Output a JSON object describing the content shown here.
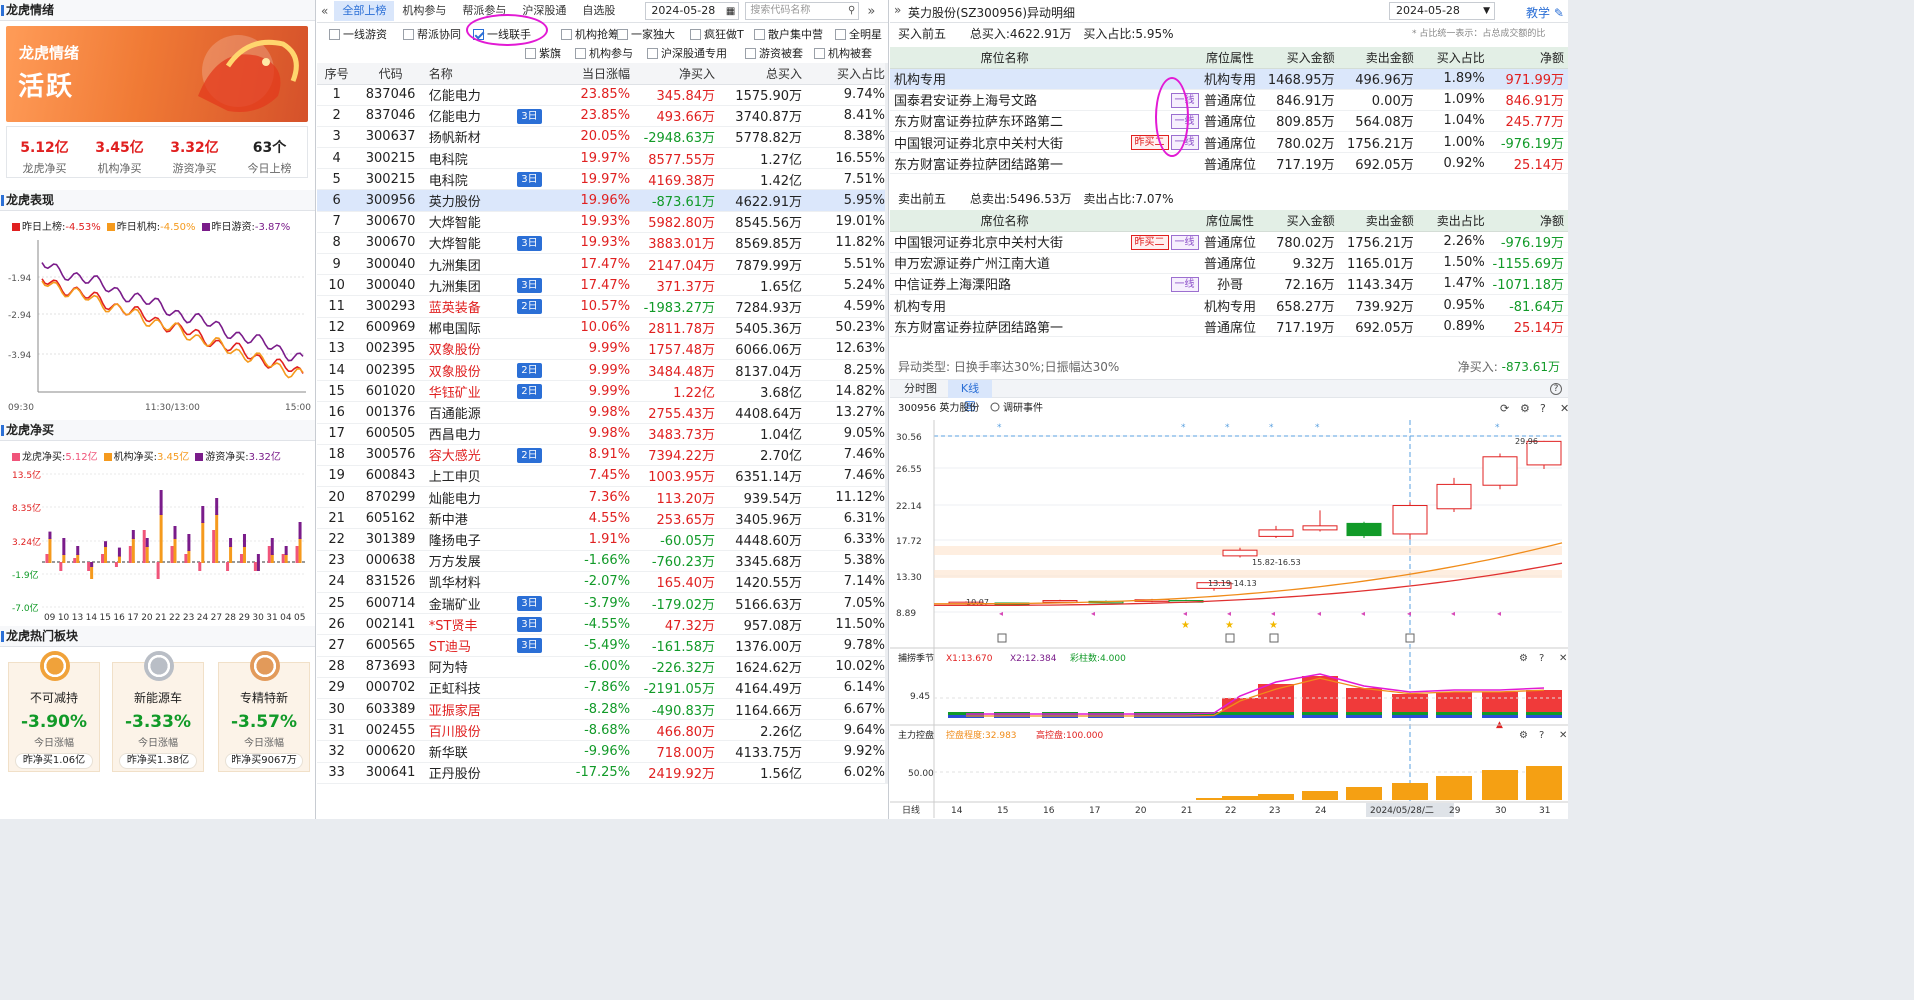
{
  "left": {
    "title": "龙虎情绪",
    "banner": {
      "subtitle": "龙虎情绪",
      "status": "活跃"
    },
    "stats": [
      {
        "value": "5.12亿",
        "label": "龙虎净买"
      },
      {
        "value": "3.45亿",
        "label": "机构净买"
      },
      {
        "value": "3.32亿",
        "label": "游资净买"
      },
      {
        "value": "63个",
        "label": "今日上榜"
      }
    ],
    "perf": {
      "title": "龙虎表现",
      "legend": [
        {
          "label": "昨日上榜:",
          "value": "-4.53%",
          "color": "#e02020"
        },
        {
          "label": "昨日机构:",
          "value": "-4.50%",
          "color": "#f59a1d"
        },
        {
          "label": "昨日游资:",
          "value": "-3.87%",
          "color": "#7a1c8a"
        }
      ],
      "yticks": [
        "-1.94",
        "-2.94",
        "-3.94"
      ],
      "xticks": [
        "09:30",
        "11:30/13:00",
        "15:00"
      ]
    },
    "net": {
      "title": "龙虎净买",
      "legend": [
        {
          "label": "龙虎净买:",
          "value": "5.12亿",
          "color": "#f0557a"
        },
        {
          "label": "机构净买:",
          "value": "3.45亿",
          "color": "#f59a1d"
        },
        {
          "label": "游资净买:",
          "value": "3.32亿",
          "color": "#7a1c8a"
        }
      ],
      "yticks": [
        "13.5亿",
        "8.35亿",
        "3.24亿",
        "-1.9亿",
        "-7.0亿"
      ],
      "xticks": [
        "09",
        "10",
        "13",
        "14",
        "15",
        "16",
        "17",
        "20",
        "21",
        "22",
        "23",
        "24",
        "27",
        "28",
        "29",
        "30",
        "31",
        "04",
        "05"
      ]
    },
    "hot": {
      "title": "龙虎热门板块",
      "cards": [
        {
          "name": "不可减持",
          "pct": "-3.90%",
          "sub": "今日涨幅",
          "buy": "昨净买1.06亿",
          "medal": "#f0a23a"
        },
        {
          "name": "新能源车",
          "pct": "-3.33%",
          "sub": "今日涨幅",
          "buy": "昨净买1.38亿",
          "medal": "#b9bec6"
        },
        {
          "name": "专精特新",
          "pct": "-3.57%",
          "sub": "今日涨幅",
          "buy": "昨净买9067万",
          "medal": "#e29a5a"
        }
      ]
    }
  },
  "mid": {
    "tabs": [
      "全部上榜",
      "机构参与",
      "帮派参与",
      "沪深股通",
      "自选股"
    ],
    "date": "2024-05-28",
    "search_placeholder": "搜索代码名称",
    "filters": [
      {
        "label": "一线游资",
        "on": false
      },
      {
        "label": "帮派协同",
        "on": false
      },
      {
        "label": "一线联手",
        "on": true
      },
      {
        "label": "机构抢筹",
        "on": false
      },
      {
        "label": "一家独大",
        "on": false
      },
      {
        "label": "疯狂做T",
        "on": false
      },
      {
        "label": "散户集中营",
        "on": false
      },
      {
        "label": "全明星",
        "on": false
      },
      {
        "label": "紫旗",
        "on": false
      },
      {
        "label": "机构参与",
        "on": false
      },
      {
        "label": "沪深股通专用",
        "on": false
      },
      {
        "label": "游资被套",
        "on": false
      },
      {
        "label": "机构被套",
        "on": false
      }
    ],
    "columns": [
      "序号",
      "代码",
      "名称",
      "",
      "当日涨幅",
      "净买入",
      "总买入",
      "买入占比"
    ],
    "rows": [
      [
        "1",
        "837046",
        "亿能电力",
        "",
        "23.85%",
        "345.84万",
        "1575.90万",
        "9.74%"
      ],
      [
        "2",
        "837046",
        "亿能电力",
        "3日",
        "23.85%",
        "493.66万",
        "3740.87万",
        "8.41%"
      ],
      [
        "3",
        "300637",
        "扬帆新材",
        "",
        "20.05%",
        "-2948.63万",
        "5778.82万",
        "8.38%"
      ],
      [
        "4",
        "300215",
        "电科院",
        "",
        "19.97%",
        "8577.55万",
        "1.27亿",
        "16.55%"
      ],
      [
        "5",
        "300215",
        "电科院",
        "3日",
        "19.97%",
        "4169.38万",
        "1.42亿",
        "7.51%"
      ],
      [
        "6",
        "300956",
        "英力股份",
        "",
        "19.96%",
        "-873.61万",
        "4622.91万",
        "5.95%"
      ],
      [
        "7",
        "300670",
        "大烨智能",
        "",
        "19.93%",
        "5982.80万",
        "8545.56万",
        "19.01%"
      ],
      [
        "8",
        "300670",
        "大烨智能",
        "3日",
        "19.93%",
        "3883.01万",
        "8569.85万",
        "11.82%"
      ],
      [
        "9",
        "300040",
        "九洲集团",
        "",
        "17.47%",
        "2147.04万",
        "7879.99万",
        "5.51%"
      ],
      [
        "10",
        "300040",
        "九洲集团",
        "3日",
        "17.47%",
        "371.37万",
        "1.65亿",
        "5.24%"
      ],
      [
        "11",
        "300293",
        "蓝英装备",
        "2日",
        "10.57%",
        "-1983.27万",
        "7284.93万",
        "4.59%"
      ],
      [
        "12",
        "600969",
        "郴电国际",
        "",
        "10.06%",
        "2811.78万",
        "5405.36万",
        "50.23%"
      ],
      [
        "13",
        "002395",
        "双象股份",
        "",
        "9.99%",
        "1757.48万",
        "6066.06万",
        "12.63%"
      ],
      [
        "14",
        "002395",
        "双象股份",
        "2日",
        "9.99%",
        "3484.48万",
        "8137.04万",
        "8.25%"
      ],
      [
        "15",
        "601020",
        "华钰矿业",
        "2日",
        "9.99%",
        "1.22亿",
        "3.68亿",
        "14.82%"
      ],
      [
        "16",
        "001376",
        "百通能源",
        "",
        "9.98%",
        "2755.43万",
        "4408.64万",
        "13.27%"
      ],
      [
        "17",
        "600505",
        "西昌电力",
        "",
        "9.98%",
        "3483.73万",
        "1.04亿",
        "9.05%"
      ],
      [
        "18",
        "300576",
        "容大感光",
        "2日",
        "8.91%",
        "7394.22万",
        "2.70亿",
        "7.46%"
      ],
      [
        "19",
        "600843",
        "上工申贝",
        "",
        "7.45%",
        "1003.95万",
        "6351.14万",
        "7.46%"
      ],
      [
        "20",
        "870299",
        "灿能电力",
        "",
        "7.36%",
        "113.20万",
        "939.54万",
        "11.12%"
      ],
      [
        "21",
        "605162",
        "新中港",
        "",
        "4.55%",
        "253.65万",
        "3405.96万",
        "6.31%"
      ],
      [
        "22",
        "301389",
        "隆扬电子",
        "",
        "1.91%",
        "-60.05万",
        "4448.60万",
        "6.33%"
      ],
      [
        "23",
        "000638",
        "万方发展",
        "",
        "-1.66%",
        "-760.23万",
        "3345.68万",
        "5.38%"
      ],
      [
        "24",
        "831526",
        "凯华材料",
        "",
        "-2.07%",
        "165.40万",
        "1420.55万",
        "7.14%"
      ],
      [
        "25",
        "600714",
        "金瑞矿业",
        "3日",
        "-3.79%",
        "-179.02万",
        "5166.63万",
        "7.05%"
      ],
      [
        "26",
        "002141",
        "*ST贤丰",
        "3日",
        "-4.55%",
        "47.32万",
        "957.08万",
        "11.50%"
      ],
      [
        "27",
        "600565",
        "ST迪马",
        "3日",
        "-5.49%",
        "-161.58万",
        "1376.00万",
        "9.78%"
      ],
      [
        "28",
        "873693",
        "阿为特",
        "",
        "-6.00%",
        "-226.32万",
        "1624.62万",
        "10.02%"
      ],
      [
        "29",
        "000702",
        "正虹科技",
        "",
        "-7.86%",
        "-2191.05万",
        "4164.49万",
        "6.14%"
      ],
      [
        "30",
        "603389",
        "亚振家居",
        "",
        "-8.28%",
        "-490.83万",
        "1164.66万",
        "6.67%"
      ],
      [
        "31",
        "002455",
        "百川股份",
        "",
        "-8.68%",
        "466.80万",
        "2.26亿",
        "9.64%"
      ],
      [
        "32",
        "000620",
        "新华联",
        "",
        "-9.96%",
        "718.00万",
        "4133.75万",
        "9.92%"
      ],
      [
        "33",
        "300641",
        "正丹股份",
        "",
        "-17.25%",
        "2419.92万",
        "1.56亿",
        "6.02%"
      ]
    ],
    "red_names": [
      "蓝英装备",
      "双象股份",
      "华钰矿业",
      "容大感光",
      "*ST贤丰",
      "ST迪马",
      "亚振家居",
      "百川股份"
    ],
    "selected_row": 5
  },
  "right": {
    "title": "英力股份(SZ300956)异动明细",
    "date": "2024-05-28",
    "teach": "教学",
    "buy_head": {
      "label": "买入前五",
      "total": "总买入:4622.91万",
      "ratio": "买入占比:5.95%",
      "note": "占比统一表示：占总成交额的比"
    },
    "buy_cols": [
      "席位名称",
      "",
      "席位属性",
      "买入金额",
      "卖出金额",
      "买入占比",
      "净额"
    ],
    "buy_rows": [
      [
        "机构专用",
        "",
        "机构专用",
        "1468.95万",
        "496.96万",
        "1.89%",
        "971.99万"
      ],
      [
        "国泰君安证券上海号文路",
        "一线",
        "普通席位",
        "846.91万",
        "0.00万",
        "1.09%",
        "846.91万"
      ],
      [
        "东方财富证券拉萨东环路第二",
        "一线",
        "普通席位",
        "809.85万",
        "564.08万",
        "1.04%",
        "245.77万"
      ],
      [
        "中国银河证券北京中关村大街",
        "昨买二|一线",
        "普通席位",
        "780.02万",
        "1756.21万",
        "1.00%",
        "-976.19万"
      ],
      [
        "东方财富证券拉萨团结路第一",
        "",
        "普通席位",
        "717.19万",
        "692.05万",
        "0.92%",
        "25.14万"
      ]
    ],
    "sell_head": {
      "label": "卖出前五",
      "total": "总卖出:5496.53万",
      "ratio": "卖出占比:7.07%"
    },
    "sell_cols": [
      "席位名称",
      "",
      "席位属性",
      "买入金额",
      "卖出金额",
      "卖出占比",
      "净额"
    ],
    "sell_rows": [
      [
        "中国银河证券北京中关村大街",
        "昨买二|一线",
        "普通席位",
        "780.02万",
        "1756.21万",
        "2.26%",
        "-976.19万"
      ],
      [
        "申万宏源证券广州江南大道",
        "",
        "普通席位",
        "9.32万",
        "1165.01万",
        "1.50%",
        "-1155.69万"
      ],
      [
        "中信证券上海溧阳路",
        "一线",
        "孙哥",
        "72.16万",
        "1143.34万",
        "1.47%",
        "-1071.18万"
      ],
      [
        "机构专用",
        "",
        "机构专用",
        "658.27万",
        "739.92万",
        "0.95%",
        "-81.64万"
      ],
      [
        "东方财富证券拉萨团结路第一",
        "",
        "普通席位",
        "717.19万",
        "692.05万",
        "0.89%",
        "25.14万"
      ]
    ],
    "anomaly": "异动类型: 日换手率达30%;日振幅达30%",
    "net": {
      "label": "净买入:",
      "value": "-873.61万"
    },
    "chart_tabs": [
      "分时图",
      "K线图"
    ],
    "kline": {
      "stock": "300956 英力股份",
      "event": "调研事件",
      "yticks": [
        "30.56",
        "26.55",
        "22.14",
        "17.72",
        "13.30",
        "8.89"
      ],
      "xticks": [
        "14",
        "15",
        "16",
        "17",
        "20",
        "21",
        "22",
        "23",
        "24",
        "2024/05/28/二",
        "29",
        "30",
        "31"
      ],
      "xtick_first": "日线",
      "labels": {
        "start": "10.07",
        "l1": "13.19-14.13",
        "l2": "15.82-16.53",
        "hi": "29.96"
      },
      "osc": {
        "name": "捕捞季节",
        "x1": "X1:13.670",
        "x2": "X2:12.384",
        "cai": "彩柱数:4.000",
        "ytick": "9.45"
      },
      "ctrl": {
        "name": "主力控盘",
        "deg": "控盘程度:32.983",
        "hi": "高控盘:100.000",
        "ytick": "50.00"
      }
    }
  }
}
